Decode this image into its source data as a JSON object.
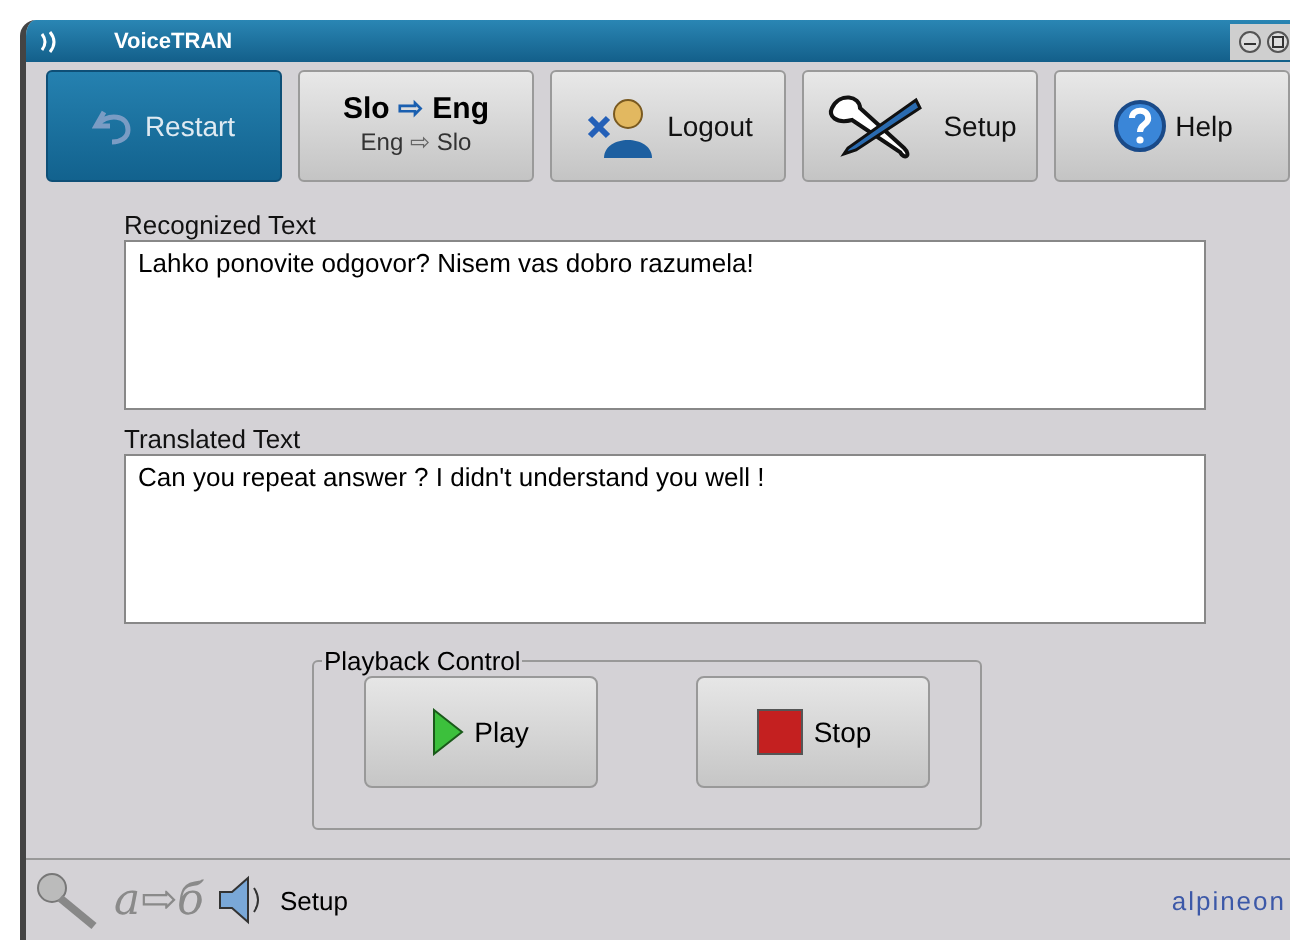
{
  "window": {
    "title": "VoiceTRAN"
  },
  "toolbar": [
    {
      "kind": "restart",
      "label": "Restart",
      "selected": true
    },
    {
      "kind": "language",
      "directions": [
        {
          "from": "Slo",
          "arrow": "⇨",
          "to": "Eng",
          "selected": true
        },
        {
          "from": "Eng",
          "arrow": "⇨",
          "to": "Slo",
          "selected": false
        }
      ]
    },
    {
      "kind": "logout",
      "label": "Logout",
      "selected": false
    },
    {
      "kind": "setup",
      "label": "Setup",
      "selected": false
    },
    {
      "kind": "help",
      "label": "Help",
      "selected": false
    }
  ],
  "recognized": {
    "label": "Recognized Text",
    "value": "Lahko ponovite odgovor? Nisem vas dobro razumela!"
  },
  "translated": {
    "label": "Translated Text",
    "value": "Can you repeat answer ? I didn't understand you well !"
  },
  "playback": {
    "legend": "Playback Control",
    "buttons": [
      {
        "kind": "play",
        "label": "Play"
      },
      {
        "kind": "stop",
        "label": "Stop"
      }
    ]
  },
  "status_bar": {
    "translit": "a⇨б",
    "setup": "Setup",
    "brand": "alpineon"
  }
}
